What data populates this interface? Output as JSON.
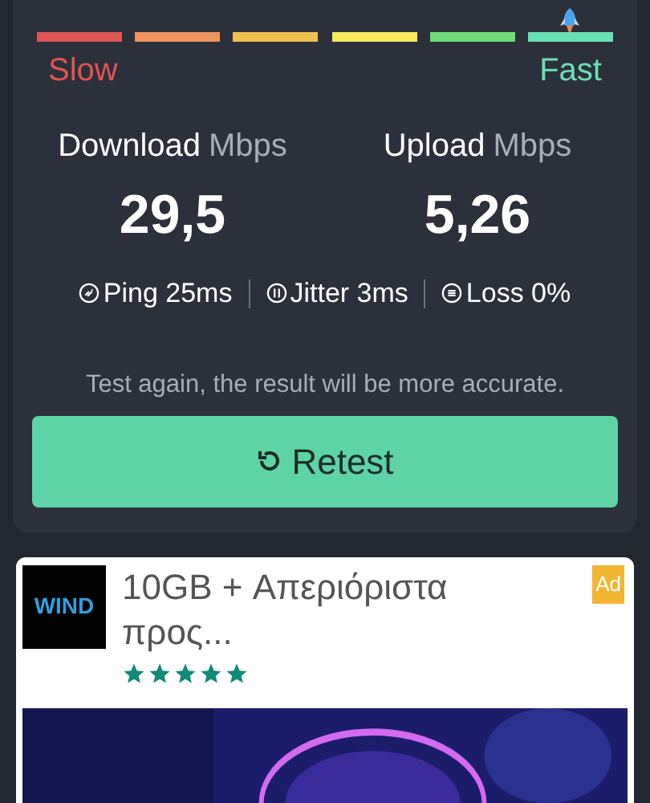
{
  "speed_scale": {
    "segments": [
      {
        "color": "#e05552",
        "selected": false
      },
      {
        "color": "#ee935b",
        "selected": false
      },
      {
        "color": "#f2c050",
        "selected": false
      },
      {
        "color": "#f7e95a",
        "selected": false
      },
      {
        "color": "#6fdc78",
        "selected": false
      },
      {
        "color": "#6ae0b3",
        "selected": true
      }
    ],
    "slow_label": "Slow",
    "fast_label": "Fast"
  },
  "results": [
    {
      "label": "Download",
      "unit": "Mbps",
      "value": "29,5"
    },
    {
      "label": "Upload",
      "unit": "Mbps",
      "value": "5,26"
    }
  ],
  "stats": [
    {
      "kind": "ping",
      "text": "Ping 25ms"
    },
    {
      "kind": "jitter",
      "text": "Jitter 3ms"
    },
    {
      "kind": "loss",
      "text": "Loss 0%"
    }
  ],
  "hint": "Test again, the result will be more accurate.",
  "retest_button": "Retest",
  "ad": {
    "logo": "WIND",
    "title": "10GB + Απεριόριστα προς...",
    "badge": "Ad",
    "stars": 5
  }
}
